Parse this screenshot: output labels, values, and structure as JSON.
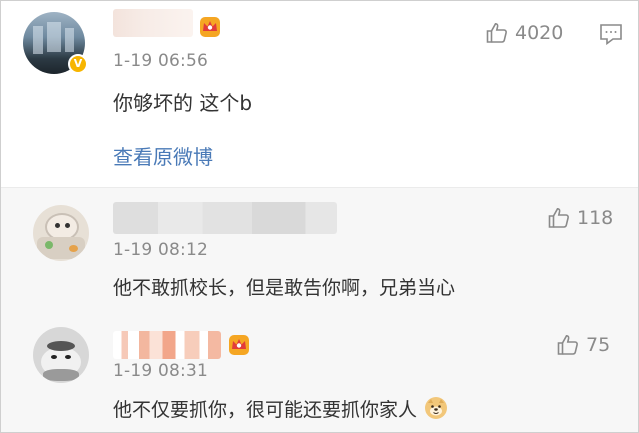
{
  "main_comment": {
    "timestamp": "1-19 06:56",
    "text": "你够坏的 这个b",
    "link_label": "查看原微博",
    "likes": "4020",
    "verified_mark": "V"
  },
  "replies": [
    {
      "timestamp": "1-19 08:12",
      "text": "他不敢抓校长，但是敢告你啊，兄弟当心",
      "likes": "118"
    },
    {
      "timestamp": "1-19 08:31",
      "text": "他不仅要抓你，很可能还要抓你家人",
      "likes": "75",
      "emoji": "doge-emoji"
    }
  ],
  "colors": {
    "accent_link": "#4a7ab7",
    "meta_gray": "#8a8a8a",
    "body_text": "#333333",
    "reply_bg": "#f7f7f7",
    "verified_badge": "#f7b500"
  }
}
